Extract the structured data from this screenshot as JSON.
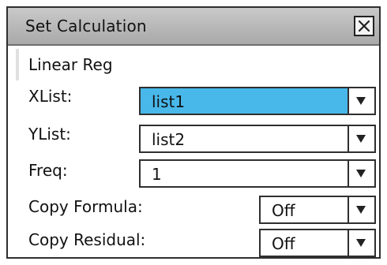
{
  "dialog": {
    "title": "Set Calculation",
    "close_icon": "close-x-icon"
  },
  "section": {
    "label": "Linear Reg"
  },
  "fields": [
    {
      "label": "XList:",
      "value": "list1",
      "selected": true
    },
    {
      "label": "YList:",
      "value": "list2",
      "selected": false
    },
    {
      "label": "Freq:",
      "value": "1",
      "selected": false
    },
    {
      "label": "Copy Formula:",
      "value": "Off",
      "selected": false
    },
    {
      "label": "Copy Residual:",
      "value": "Off",
      "selected": false
    }
  ],
  "colors": {
    "selection": "#48b8ea",
    "titlebar": "#b5b5b5",
    "border": "#2f2f2f"
  }
}
